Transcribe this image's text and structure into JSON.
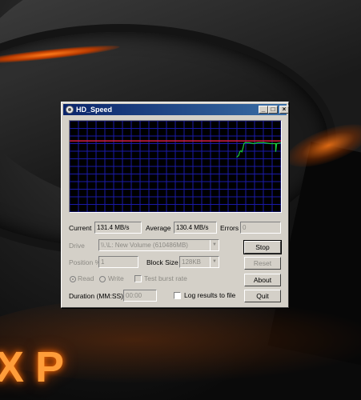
{
  "window": {
    "title": "HD_Speed",
    "minimize": "_",
    "maximize": "□",
    "close": "×"
  },
  "stats": {
    "current_label": "Current",
    "current_value": "131.4 MB/s",
    "average_label": "Average",
    "average_value": "130.4 MB/s",
    "errors_label": "Errors",
    "errors_value": "0"
  },
  "drive": {
    "label": "Drive",
    "value": "\\\\.\\L: New Volume (610486MB)"
  },
  "position": {
    "label": "Position %",
    "value": "1"
  },
  "block_size": {
    "label": "Block Size",
    "value": "128KB"
  },
  "mode": {
    "read_label": "Read",
    "write_label": "Write",
    "burst_label": "Test burst rate",
    "selected": "Read"
  },
  "duration": {
    "label": "Duration (MM:SS)",
    "value": "00:00"
  },
  "log": {
    "label": "Log results to file",
    "checked": false
  },
  "buttons": {
    "stop": "Stop",
    "reset": "Reset",
    "about": "About",
    "quit": "Quit"
  },
  "desktop": {
    "logo_text": "XP"
  },
  "graph": {
    "background": "#000000",
    "grid_color": "#1a1aa8",
    "max_line_color": "#d62040",
    "speed_line_color": "#19c83a",
    "speed_trace": [
      [
        0.79,
        0.4
      ],
      [
        0.8,
        0.38
      ],
      [
        0.805,
        0.34
      ],
      [
        0.81,
        0.33
      ],
      [
        0.815,
        0.34
      ],
      [
        0.82,
        0.3
      ],
      [
        0.825,
        0.25
      ],
      [
        0.83,
        0.24
      ],
      [
        0.85,
        0.24
      ],
      [
        0.87,
        0.25
      ],
      [
        0.89,
        0.24
      ],
      [
        0.92,
        0.24
      ],
      [
        0.95,
        0.25
      ],
      [
        0.975,
        0.25
      ],
      [
        0.975,
        0.34
      ],
      [
        0.98,
        0.25
      ],
      [
        1.0,
        0.24
      ]
    ],
    "max_line_level": 0.22
  },
  "colors": {
    "title_start": "#0a246a",
    "title_end": "#3a6ea5",
    "face": "#d4d0c8",
    "disabled_text": "#8c8a84"
  }
}
